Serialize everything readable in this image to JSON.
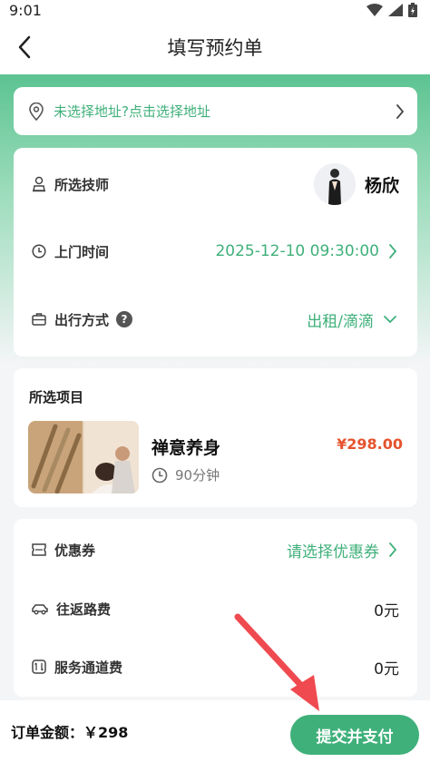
{
  "status_bar": {
    "time": "9:01"
  },
  "nav": {
    "title": "填写预约单"
  },
  "address": {
    "placeholder": "未选择地址?点击选择地址"
  },
  "info": {
    "technician": {
      "label": "所选技师",
      "name": "杨欣"
    },
    "visit_time": {
      "label": "上门时间",
      "value": "2025-12-10 09:30:00"
    },
    "travel": {
      "label": "出行方式",
      "help": "?",
      "value": "出租/滴滴"
    }
  },
  "project": {
    "heading": "所选项目",
    "name": "禅意养身",
    "price": "¥298.00",
    "duration": "90分钟"
  },
  "fees": {
    "coupon": {
      "label": "优惠券",
      "value": "请选择优惠券"
    },
    "travel_fee": {
      "label": "往返路费",
      "value": "0元"
    },
    "channel_fee": {
      "label": "服务通道费",
      "value": "0元"
    }
  },
  "footer": {
    "total": "订单金额：￥298",
    "submit": "提交并支付"
  },
  "colors": {
    "accent": "#3fb07a",
    "price": "#e5532e",
    "arrow": "#ef4a4f"
  }
}
